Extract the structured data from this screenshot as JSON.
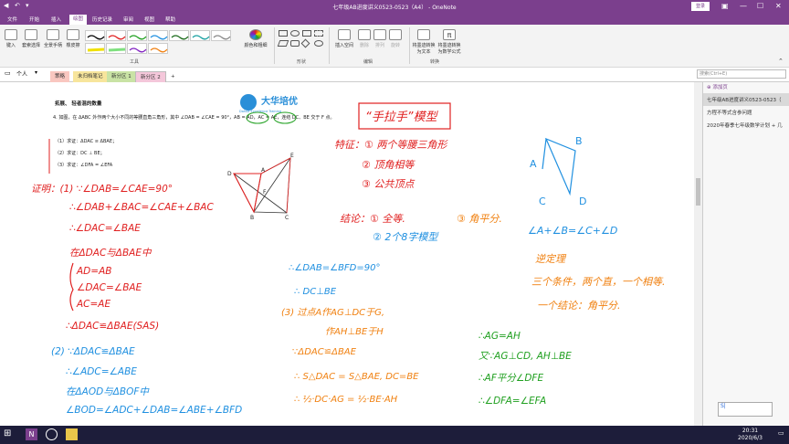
{
  "app": {
    "title": "七年级AB进度讲义0523-0523（A4） - OneNote",
    "login": "登录",
    "winbtns": [
      "🗖",
      "—",
      "☐",
      "✕"
    ]
  },
  "menu": [
    "文件",
    "开始",
    "插入",
    "绘图",
    "历史记录",
    "审阅",
    "视图",
    "帮助"
  ],
  "menu_active": "绘图",
  "ribbon": {
    "buttons": [
      {
        "label": "键入"
      },
      {
        "label": "套索选择"
      },
      {
        "label": "全景手柄"
      },
      {
        "label": "橡皮擦"
      }
    ],
    "color_btn": "颜色和粗细",
    "group_tools": "工具",
    "shapes_group": "形状",
    "insert_space": "插入空间",
    "delete": "删除",
    "arrange": "排列",
    "rotate": "旋转",
    "edit_group": "编辑",
    "ink_to_text": "将墨迹转换为文本",
    "ink_to_math": "将墨迹转换为数学公式",
    "convert_group": "转换"
  },
  "notebook": {
    "name": "个人",
    "tabs": [
      "策略",
      "未归档笔记",
      "新分区 1",
      "新分区 2"
    ],
    "add": "+",
    "search_placeholder": "搜索(Ctrl+E)"
  },
  "pages": {
    "add": "添加页",
    "items": [
      "七年级AB进度讲义0523-0523（",
      "方程不等式含参问题",
      "2020年春季七年级数学计划 + 几"
    ]
  },
  "doc": {
    "section_title": "拓展、 轻者混的数量",
    "problem": "4. 如图，在 ΔABC 外作两个大小不同的等腰直角三角形，其中 ∠DAB = ∠CAE = 90°，AB = AD，AC = AE，连结 DC、BE 交于 F 点。",
    "q1": "（1）求证：ΔDAC ≌ ΔBAE；",
    "q2": "（2）求证：DC ⊥ BE；",
    "q3": "（3）求证：∠DFA = ∠EFA",
    "logo_cn": "大华培优",
    "logo_en": "Dahua Excellence Training",
    "fig_labels": [
      "D",
      "E",
      "A",
      "F",
      "B",
      "C"
    ]
  },
  "ink": {
    "box_title": "“手拉手”模型",
    "features": "特征：① 两个等腰三角形",
    "f2": "② 顶角相等",
    "f3": "③ 公共顶点",
    "conclusion": "结论：① 全等.",
    "c2": "② 2个8字模型",
    "c3": "③ 角平分.",
    "p1": "证明：(1) ∵∠DAB=∠CAE=90°",
    "p2": "∴∠DAB+∠BAC=∠CAE+∠BAC",
    "p3": "∴∠DAC=∠BAE",
    "p4": "在ΔDAC与ΔBAE中",
    "p5": "AD=AB",
    "p6": "∠DAC=∠BAE",
    "p7": "AC=AE",
    "p8": "∴ΔDAC≌ΔBAE(SAS)",
    "p9": "(2) ∵ΔDAC≌ΔBAE",
    "p10": "∴∠ADC=∠ABE",
    "p11": "在ΔAOD与ΔBOF中",
    "p12": "∠BOD=∠ADC+∠DAB=∠ABE+∠BFD",
    "m1": "∴∠DAB=∠BFD=90°",
    "m2": "∴ DC⊥BE",
    "m3": "(3) 过点A作AG⊥DC于G,",
    "m4": "作AH⊥BE于H",
    "m5": "∵ΔDAC≌ΔBAE",
    "m6": "∴ S△DAC = S△BAE, DC=BE",
    "m7": "∴ ½·DC·AG = ½·BE·AH",
    "r1": "∴AG=AH",
    "r2": "又∵AG⊥CD, AH⊥BE",
    "r3": "∴AF平分∠DFE",
    "r4": "∴∠DFA=∠EFA",
    "angle_eq": "∠A+∠B=∠C+∠D",
    "inv_title": "逆定理",
    "inv1": "三个条件，两个直，一个相等.",
    "inv2": "一个结论：角平分.",
    "fig2": [
      "B",
      "A",
      "C",
      "D"
    ]
  },
  "taskbar": {
    "time": "20:31",
    "date": "2020/6/3"
  }
}
